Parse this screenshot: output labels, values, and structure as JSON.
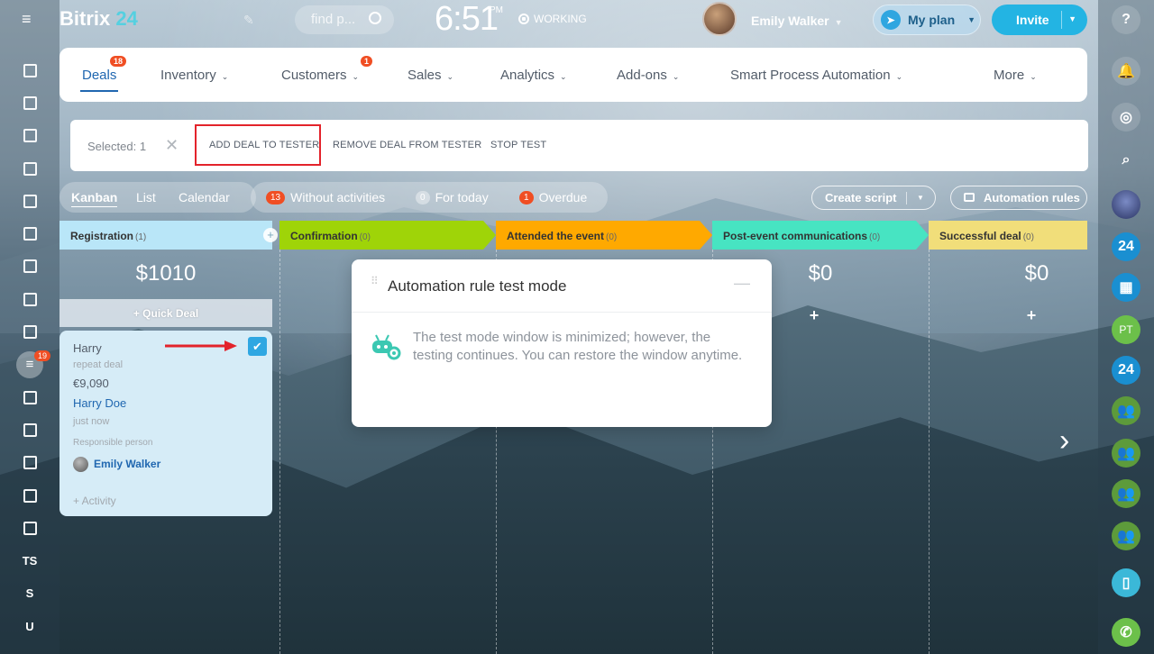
{
  "header": {
    "logo_brand": "Bitrix",
    "logo_num": "24",
    "search_placeholder": "find p...",
    "clock": "6:51",
    "clock_ampm": "PM",
    "status": "WORKING",
    "user_name": "Emily Walker",
    "my_plan_label": "My plan",
    "invite_label": "Invite"
  },
  "left_sidebar": {
    "items": [
      {
        "icon": "pie-chart-icon"
      },
      {
        "icon": "feed-icon"
      },
      {
        "icon": "chat-icon"
      },
      {
        "icon": "calendar-icon"
      },
      {
        "icon": "document-icon"
      },
      {
        "icon": "drive-icon"
      },
      {
        "icon": "people-icon"
      },
      {
        "icon": "mail-icon"
      },
      {
        "icon": "tasks-icon"
      },
      {
        "icon": "crm-filter-icon",
        "badge": "19",
        "active": true
      },
      {
        "icon": "target-icon"
      },
      {
        "icon": "cart-icon"
      },
      {
        "icon": "contact-card-icon"
      },
      {
        "icon": "box-icon"
      },
      {
        "icon": "box-2-icon"
      },
      {
        "label": "TS"
      },
      {
        "label": "S"
      },
      {
        "label": "U"
      }
    ]
  },
  "main_nav": {
    "items": [
      {
        "label": "Deals",
        "badge": "18",
        "active": true
      },
      {
        "label": "Inventory",
        "dropdown": true
      },
      {
        "label": "Customers",
        "dropdown": true,
        "badge": "1"
      },
      {
        "label": "Sales",
        "dropdown": true
      },
      {
        "label": "Analytics",
        "dropdown": true
      },
      {
        "label": "Add-ons",
        "dropdown": true
      },
      {
        "label": "Smart Process Automation",
        "dropdown": true
      },
      {
        "label": "More",
        "dropdown": true
      }
    ]
  },
  "action_bar": {
    "selected_label": "Selected: 1",
    "add_deal": "ADD DEAL TO TESTER",
    "remove_deal": "REMOVE DEAL FROM TESTER",
    "stop_test": "STOP TEST"
  },
  "view_tabs": [
    "Kanban",
    "List",
    "Calendar"
  ],
  "counters": {
    "without_activities": {
      "count": "13",
      "label": "Without activities"
    },
    "for_today": {
      "count": "0",
      "label": "For today"
    },
    "overdue": {
      "count": "1",
      "label": "Overdue"
    }
  },
  "toolbar": {
    "create_script": "Create script",
    "automation_rules": "Automation rules"
  },
  "stages": [
    {
      "name": "Registration",
      "count": "(1)",
      "color": "#b9e6f8",
      "sum": "$1010"
    },
    {
      "name": "Confirmation",
      "count": "(0)",
      "color": "#9fd408"
    },
    {
      "name": "Attended the event",
      "count": "(0)",
      "color": "#ffa900"
    },
    {
      "name": "Post-event communications",
      "count": "(0)",
      "color": "#47e4c2",
      "sum": "$0"
    },
    {
      "name": "Successful deal",
      "count": "(0)",
      "color": "#f1de7a",
      "sum": "$0"
    }
  ],
  "quick_deal": "+ Quick Deal",
  "deal_card": {
    "title": "Harry",
    "subtitle": "repeat deal",
    "amount": "€9,090",
    "contact": "Harry Doe",
    "time": "just now",
    "responsible_label": "Responsible person",
    "responsible": "Emily Walker",
    "activity": "+ Activity",
    "checked": true
  },
  "dialog": {
    "title": "Automation rule test mode",
    "message": "The test mode window is minimized; however, the testing continues. You can restore the window anytime."
  },
  "right_sidebar": {
    "items": [
      {
        "icon": "help-icon",
        "label": "?"
      },
      {
        "icon": "bell-icon"
      },
      {
        "icon": "chat-bubble-icon"
      },
      {
        "icon": "search-icon"
      },
      {
        "icon": "globe-avatar-icon"
      },
      {
        "icon": "bitrix24-icon",
        "label": "24"
      },
      {
        "icon": "calendar-icon"
      },
      {
        "icon": "pt-avatar",
        "label": "PT"
      },
      {
        "icon": "bitrix24-icon",
        "label": "24"
      },
      {
        "icon": "group-icon"
      },
      {
        "icon": "group-icon"
      },
      {
        "icon": "group-icon"
      },
      {
        "icon": "group-icon"
      },
      {
        "icon": "mobile-icon"
      },
      {
        "icon": "phone-icon"
      }
    ]
  },
  "colors": {
    "accent": "#2067b0",
    "invite": "#23b4e3",
    "badge": "#f04e23",
    "highlight": "#e3232b"
  }
}
